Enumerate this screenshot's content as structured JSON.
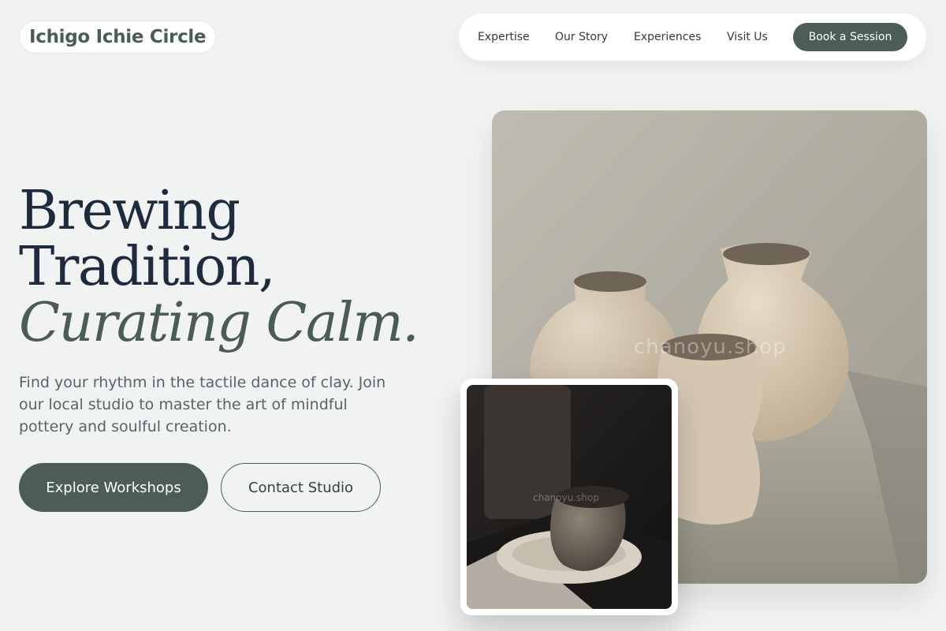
{
  "brand": {
    "name": "Ichigo Ichie Circle"
  },
  "nav": {
    "links": [
      "Expertise",
      "Our Story",
      "Experiences",
      "Visit Us"
    ],
    "cta": "Book a Session"
  },
  "hero": {
    "line1": "Brewing",
    "line2": "Tradition,",
    "line3": "Curating Calm.",
    "lede": "Find your rhythm in the tactile dance of clay. Join our local studio to master the art of mindful pottery and soulful creation.",
    "primary_button": "Explore Workshops",
    "secondary_button": "Contact Studio"
  },
  "images": {
    "main_watermark": "chanoyu.shop",
    "small_watermark": "chanoyu.shop",
    "main_icon": "ceramic-vases-photo",
    "small_icon": "tea-cup-photo"
  },
  "colors": {
    "accent": "#4b5c59",
    "background": "#f1f3f2",
    "heading": "#1e2b3e"
  }
}
